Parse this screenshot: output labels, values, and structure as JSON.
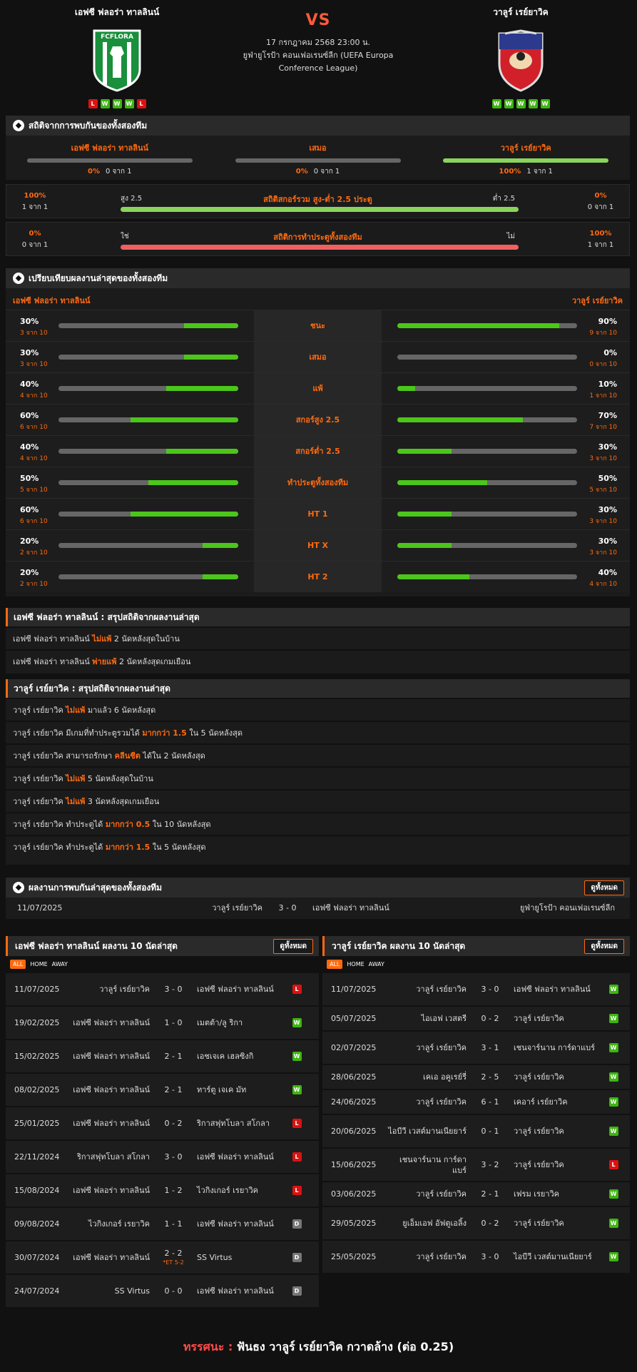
{
  "match": {
    "home": "เอฟซี ฟลอร่า ทาลลินน์",
    "away": "วาลูร์ เรย์ยาวิค",
    "vs": "VS",
    "date": "17 กรกฎาคม 2568 23:00 น.",
    "competition_line1": "ยูฟ่ายูโรป้า คอนเฟอเรนซ์ลีก (UEFA Europa",
    "competition_line2": "Conference League)",
    "home_logo_text": "FCFLORA",
    "home_form": [
      "L",
      "W",
      "W",
      "W",
      "L"
    ],
    "away_form": [
      "W",
      "W",
      "W",
      "W",
      "W"
    ]
  },
  "h2h": {
    "title": "สถิติจากการพบกันของทั้งสองทีม",
    "cols": [
      {
        "team": "เอฟซี ฟลอร่า ทาลลินน์",
        "pct": "0%",
        "sub": "0 จาก 1",
        "fill": 0
      },
      {
        "team": "เสมอ",
        "pct": "0%",
        "sub": "0 จาก 1",
        "fill": 0
      },
      {
        "team": "วาลูร์ เรย์ยาวิค",
        "pct": "100%",
        "sub": "1 จาก 1",
        "fill": 1
      }
    ],
    "ou": {
      "left_pct": "100%",
      "left_sub": "1 จาก 1",
      "left_lbl": "สูง 2.5",
      "title": "สถิติสกอร์รวม สูง-ต่ำ 2.5 ประตู",
      "right_lbl": "ต่ำ 2.5",
      "right_pct": "0%",
      "right_sub": "0 จาก 1"
    },
    "btts": {
      "left_pct": "0%",
      "left_sub": "0 จาก 1",
      "left_lbl": "ใช่",
      "title": "สถิติการทำประตูทั้งสองทีม",
      "right_lbl": "ไม่",
      "right_pct": "100%",
      "right_sub": "1 จาก 1"
    }
  },
  "compare": {
    "title": "เปรียบเทียบผลงานล่าสุดของทั้งสองทีม",
    "home": "เอฟซี ฟลอร่า ทาลลินน์",
    "away": "วาลูร์ เรย์ยาวิค",
    "rows": [
      {
        "label": "ชนะ",
        "hp": "30%",
        "hs": "3 จาก 10",
        "hf": 0.3,
        "ap": "90%",
        "as": "9 จาก 10",
        "af": 0.9
      },
      {
        "label": "เสมอ",
        "hp": "30%",
        "hs": "3 จาก 10",
        "hf": 0.3,
        "ap": "0%",
        "as": "0 จาก 10",
        "af": 0
      },
      {
        "label": "แพ้",
        "hp": "40%",
        "hs": "4 จาก 10",
        "hf": 0.4,
        "ap": "10%",
        "as": "1 จาก 10",
        "af": 0.1
      },
      {
        "label": "สกอร์สูง 2.5",
        "hp": "60%",
        "hs": "6 จาก 10",
        "hf": 0.6,
        "ap": "70%",
        "as": "7 จาก 10",
        "af": 0.7
      },
      {
        "label": "สกอร์ต่ำ 2.5",
        "hp": "40%",
        "hs": "4 จาก 10",
        "hf": 0.4,
        "ap": "30%",
        "as": "3 จาก 10",
        "af": 0.3
      },
      {
        "label": "ทำประตูทั้งสองทีม",
        "hp": "50%",
        "hs": "5 จาก 10",
        "hf": 0.5,
        "ap": "50%",
        "as": "5 จาก 10",
        "af": 0.5
      },
      {
        "label": "HT 1",
        "hp": "60%",
        "hs": "6 จาก 10",
        "hf": 0.6,
        "ap": "30%",
        "as": "3 จาก 10",
        "af": 0.3
      },
      {
        "label": "HT X",
        "hp": "20%",
        "hs": "2 จาก 10",
        "hf": 0.2,
        "ap": "30%",
        "as": "3 จาก 10",
        "af": 0.3
      },
      {
        "label": "HT 2",
        "hp": "20%",
        "hs": "2 จาก 10",
        "hf": 0.2,
        "ap": "40%",
        "as": "4 จาก 10",
        "af": 0.4
      }
    ]
  },
  "home_summary": {
    "title": "เอฟซี ฟลอร่า ทาลลินน์ : สรุปสถิติจากผลงานล่าสุด",
    "rows": [
      [
        "เอฟซี ฟลอร่า ทาลลินน์ ",
        "ไม่แพ้",
        " 2  นัดหลังสุดในบ้าน"
      ],
      [
        "เอฟซี ฟลอร่า ทาลลินน์ ",
        "พ่ายแพ้",
        " 2  นัดหลังสุดเกมเยือน"
      ]
    ]
  },
  "away_summary": {
    "title": "วาลูร์ เรย์ยาวิค : สรุปสถิติจากผลงานล่าสุด",
    "rows": [
      [
        "วาลูร์ เรย์ยาวิค ",
        "ไม่แพ้",
        " มาแล้ว 6 นัดหลังสุด"
      ],
      [
        "วาลูร์ เรย์ยาวิค  มีเกมที่ทำประตูรวมได้ ",
        "มากกว่า 1.5",
        " ใน 5 นัดหลังสุด"
      ],
      [
        "วาลูร์ เรย์ยาวิค  สามารถรักษา ",
        "คลีนชีต",
        " ได้ใน 2 นัดหลังสุด"
      ],
      [
        "วาลูร์ เรย์ยาวิค ",
        "ไม่แพ้",
        " 5  นัดหลังสุดในบ้าน"
      ],
      [
        "วาลูร์ เรย์ยาวิค ",
        "ไม่แพ้",
        " 3  นัดหลังสุดเกมเยือน"
      ],
      [
        "วาลูร์ เรย์ยาวิค  ทำประตูได้ ",
        "มากกว่า 0.5",
        " ใน 10 นัดหลังสุด"
      ],
      [
        "วาลูร์ เรย์ยาวิค  ทำประตูได้ ",
        "มากกว่า 1.5",
        " ใน 5 นัดหลังสุด"
      ]
    ]
  },
  "last_meet": {
    "title": "ผลงานการพบกันล่าสุดของทั้งสองทีม",
    "btn": "ดูทั้งหมด",
    "date": "11/07/2025",
    "home": "วาลูร์ เรย์ยาวิค",
    "score": "3 - 0",
    "away": "เอฟซี ฟลอร่า ทาลลินน์",
    "comp": "ยูฟ่ายูโรป้า คอนเฟอเรนซ์ลีก"
  },
  "tabs": [
    "ALL",
    "HOME",
    "AWAY"
  ],
  "home_last10": {
    "title": "เอฟซี ฟลอร่า ทาลลินน์ ผลงาน 10 นัดล่าสุด",
    "btn": "ดูทั้งหมด",
    "rows": [
      {
        "d": "11/07/2025",
        "h": "วาลูร์ เรย์ยาวิค",
        "s": "3 - 0",
        "a": "เอฟซี ฟลอร่า ทาลลินน์",
        "r": "L"
      },
      {
        "d": "19/02/2025",
        "h": "เอฟซี ฟลอร่า ทาลลินน์",
        "s": "1 - 0",
        "a": "เมตต้า/ลู ริกา",
        "r": "W"
      },
      {
        "d": "15/02/2025",
        "h": "เอฟซี ฟลอร่า ทาลลินน์",
        "s": "2 - 1",
        "a": "เอชเจเค เฮลซิงกิ",
        "r": "W"
      },
      {
        "d": "08/02/2025",
        "h": "เอฟซี ฟลอร่า ทาลลินน์",
        "s": "2 - 1",
        "a": "ทาร์ตู เจเค มัท",
        "r": "W"
      },
      {
        "d": "25/01/2025",
        "h": "เอฟซี ฟลอร่า ทาลลินน์",
        "s": "0 - 2",
        "a": "ริกาสฟุทโบลา สโกลา",
        "r": "L"
      },
      {
        "d": "22/11/2024",
        "h": "ริกาสฟุทโบลา สโกลา",
        "s": "3 - 0",
        "a": "เอฟซี ฟลอร่า ทาลลินน์",
        "r": "L"
      },
      {
        "d": "15/08/2024",
        "h": "เอฟซี ฟลอร่า ทาลลินน์",
        "s": "1 - 2",
        "a": "ไวกิงเกอร์ เรยาวิค",
        "r": "L"
      },
      {
        "d": "09/08/2024",
        "h": "ไวกิงเกอร์ เรยาวิค",
        "s": "1 - 1",
        "a": "เอฟซี ฟลอร่า ทาลลินน์",
        "r": "D"
      },
      {
        "d": "30/07/2024",
        "h": "เอฟซี ฟลอร่า ทาลลินน์",
        "s": "2 - 2",
        "s2": "*ET 5-2",
        "a": "SS Virtus",
        "r": "D"
      },
      {
        "d": "24/07/2024",
        "h": "SS Virtus",
        "s": "0 - 0",
        "a": "เอฟซี ฟลอร่า ทาลลินน์",
        "r": "D"
      }
    ]
  },
  "away_last10": {
    "title": "วาลูร์ เรย์ยาวิค ผลงาน 10 นัดล่าสุด",
    "btn": "ดูทั้งหมด",
    "rows": [
      {
        "d": "11/07/2025",
        "h": "วาลูร์ เรย์ยาวิค",
        "s": "3 - 0",
        "a": "เอฟซี ฟลอร่า ทาลลินน์",
        "r": "W"
      },
      {
        "d": "05/07/2025",
        "h": "ไอเอฟ เวสตรี",
        "s": "0 - 2",
        "a": "วาลูร์ เรย์ยาวิค",
        "r": "W"
      },
      {
        "d": "02/07/2025",
        "h": "วาลูร์ เรย์ยาวิค",
        "s": "3 - 1",
        "a": "เชนจาร์นาน การ์ดาแบร์",
        "r": "W"
      },
      {
        "d": "28/06/2025",
        "h": "เคเอ อคูเรย์รี่",
        "s": "2 - 5",
        "a": "วาลูร์ เรย์ยาวิค",
        "r": "W"
      },
      {
        "d": "24/06/2025",
        "h": "วาลูร์ เรย์ยาวิค",
        "s": "6 - 1",
        "a": "เคอาร์ เรย์ยาวิค",
        "r": "W"
      },
      {
        "d": "20/06/2025",
        "h": "ไอบีวี เวสต์มานเนียยาร์",
        "s": "0 - 1",
        "a": "วาลูร์ เรย์ยาวิค",
        "r": "W"
      },
      {
        "d": "15/06/2025",
        "h": "เชนจาร์นาน การ์ดาแบร์",
        "s": "3 - 2",
        "a": "วาลูร์ เรย์ยาวิค",
        "r": "L"
      },
      {
        "d": "03/06/2025",
        "h": "วาลูร์ เรย์ยาวิค",
        "s": "2 - 1",
        "a": "เฟรม เรยาวิค",
        "r": "W"
      },
      {
        "d": "29/05/2025",
        "h": "ยูเอ็มเอฟ อัฟตูเอลิ้ง",
        "s": "0 - 2",
        "a": "วาลูร์ เรย์ยาวิค",
        "r": "W"
      },
      {
        "d": "25/05/2025",
        "h": "วาลูร์ เรย์ยาวิค",
        "s": "3 - 0",
        "a": "ไอบีวี เวสต์มานเนียยาร์",
        "r": "W"
      }
    ]
  },
  "verdict": {
    "key": "ทรรศนะ :",
    "text": "ฟันธง วาลูร์ เรย์ยาวิค กวาดล้าง (ต่อ 0.25)"
  },
  "colors": {
    "accent": "#ff6a10",
    "win": "#3eb512",
    "loss": "#dd1111",
    "draw": "#777777"
  }
}
